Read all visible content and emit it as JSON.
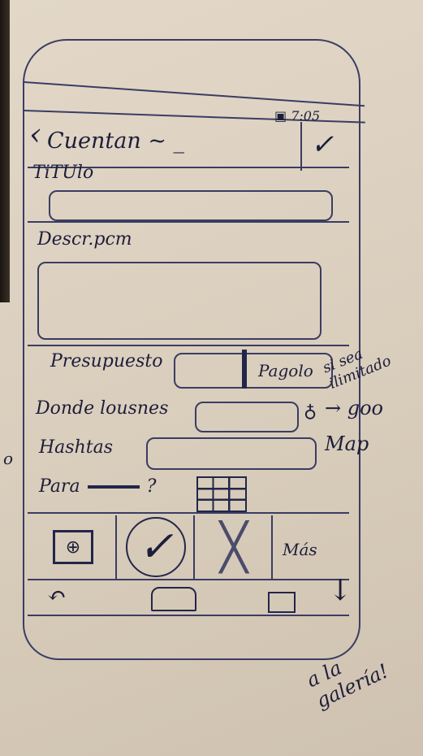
{
  "status_bar": {
    "time": "7:05"
  },
  "header": {
    "back_icon": "chevron-left-icon",
    "title": "Cuentan ~ _",
    "confirm_icon": "check-icon"
  },
  "form": {
    "titulo_label": "TiTUlo",
    "descripcion_label": "Descr.pcm",
    "presupuesto_label": "Presupuesto",
    "presupuesto_toggle": "Pagolo",
    "donde_label": "Donde lousnes",
    "hashtags_label": "Hashtas",
    "para_label": "Para",
    "para_suffix": "?"
  },
  "attachments": {
    "more_label": "Más"
  },
  "annotations": {
    "budget_note": "si sea ilimitado",
    "maps_note": "→ goo Map",
    "gallery_note": "a la galería!",
    "left_edge_note": "o"
  }
}
